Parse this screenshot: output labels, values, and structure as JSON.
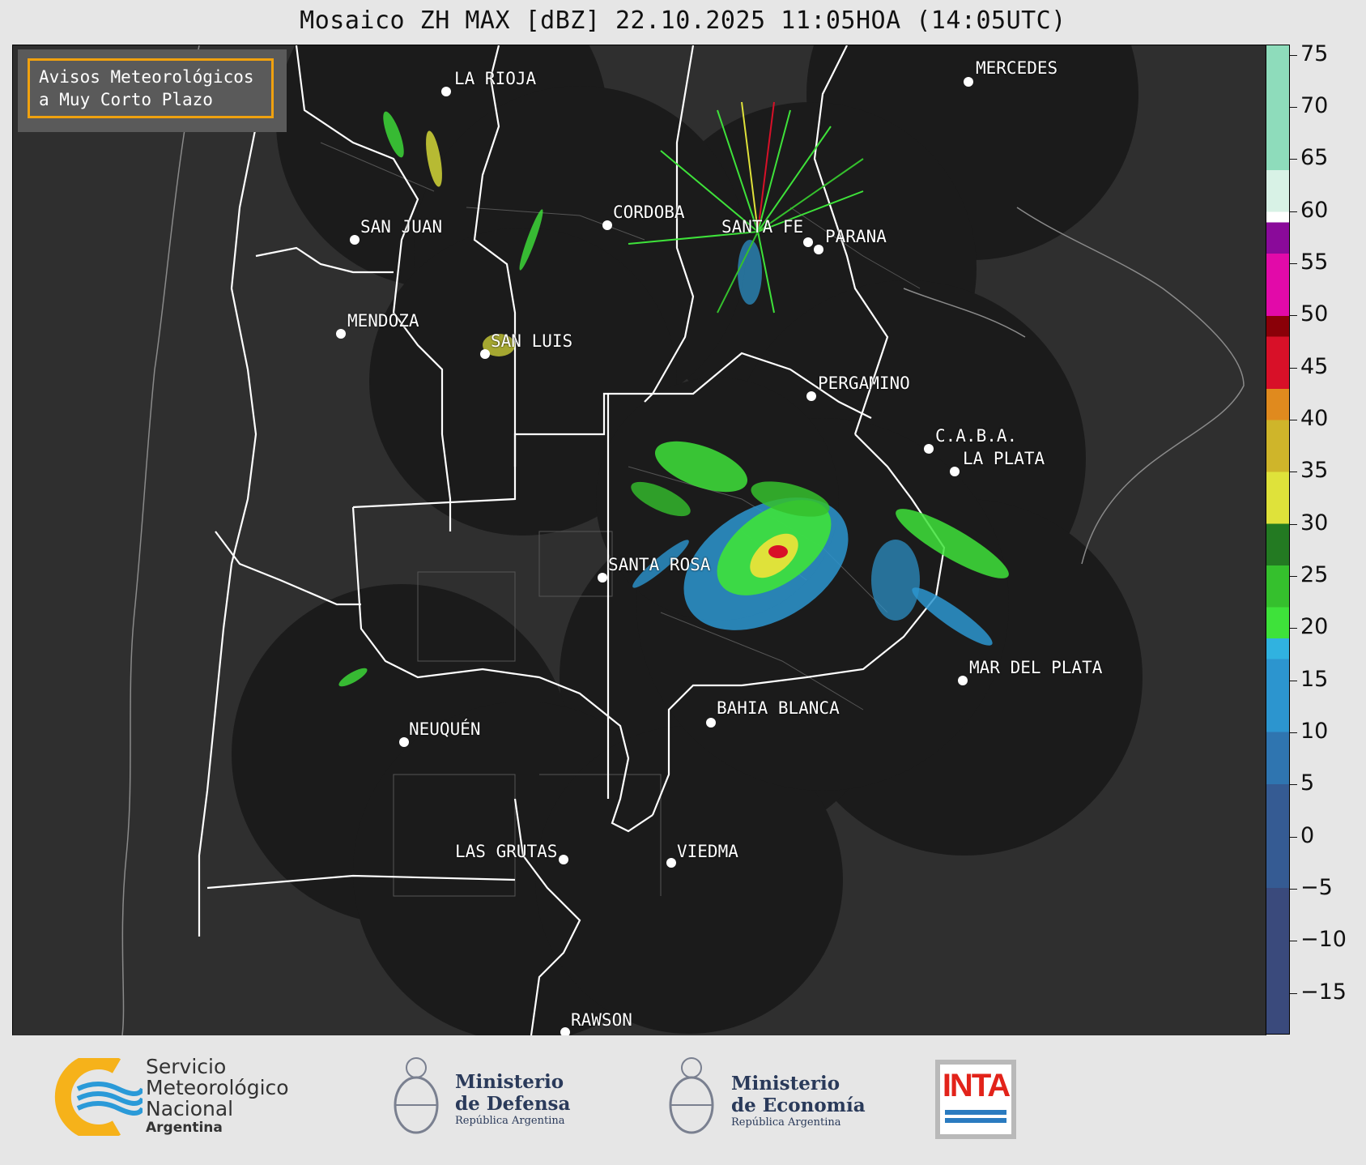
{
  "title": "Mosaico ZH MAX [dBZ] 22.10.2025 11:05HOA (14:05UTC)",
  "avisos": {
    "line1": "Avisos Meteorológicos",
    "line2": "a Muy Corto Plazo"
  },
  "cities": [
    {
      "id": "la-rioja",
      "label": "LA RIOJA"
    },
    {
      "id": "mercedes",
      "label": "MERCEDES"
    },
    {
      "id": "cordoba",
      "label": "CORDOBA"
    },
    {
      "id": "san-juan",
      "label": "SAN JUAN"
    },
    {
      "id": "santa-fe",
      "label": "SANTA FE"
    },
    {
      "id": "parana",
      "label": "PARANA"
    },
    {
      "id": "mendoza",
      "label": "MENDOZA"
    },
    {
      "id": "san-luis",
      "label": "SAN LUIS"
    },
    {
      "id": "pergamino",
      "label": "PERGAMINO"
    },
    {
      "id": "caba",
      "label": "C.A.B.A."
    },
    {
      "id": "la-plata",
      "label": "LA PLATA"
    },
    {
      "id": "santa-rosa",
      "label": "SANTA ROSA"
    },
    {
      "id": "mar-del-plata",
      "label": "MAR DEL PLATA"
    },
    {
      "id": "bahia-blanca",
      "label": "BAHIA BLANCA"
    },
    {
      "id": "neuquen",
      "label": "NEUQUÉN"
    },
    {
      "id": "las-grutas",
      "label": "LAS GRUTAS"
    },
    {
      "id": "viedma",
      "label": "VIEDMA"
    },
    {
      "id": "rawson",
      "label": "RAWSON"
    }
  ],
  "colorbar": {
    "unit": "dBZ",
    "ticks": [
      "75",
      "70",
      "65",
      "60",
      "55",
      "50",
      "45",
      "40",
      "35",
      "30",
      "25",
      "20",
      "15",
      "10",
      "5",
      "0",
      "−5",
      "−10",
      "−15"
    ],
    "min": -19,
    "max": 76,
    "bands": [
      {
        "from": -19,
        "to": -5,
        "color": "#3a4a7c"
      },
      {
        "from": -5,
        "to": 5,
        "color": "#355b93"
      },
      {
        "from": 5,
        "to": 10,
        "color": "#2f75b0"
      },
      {
        "from": 10,
        "to": 17,
        "color": "#2c95cf"
      },
      {
        "from": 17,
        "to": 19,
        "color": "#30b2e0"
      },
      {
        "from": 19,
        "to": 22,
        "color": "#3ee23a"
      },
      {
        "from": 22,
        "to": 26,
        "color": "#35c02d"
      },
      {
        "from": 26,
        "to": 30,
        "color": "#237a22"
      },
      {
        "from": 30,
        "to": 35,
        "color": "#dfe23a"
      },
      {
        "from": 35,
        "to": 40,
        "color": "#cfb52a"
      },
      {
        "from": 40,
        "to": 43,
        "color": "#e08a1e"
      },
      {
        "from": 43,
        "to": 48,
        "color": "#d81028"
      },
      {
        "from": 48,
        "to": 50,
        "color": "#8a0008"
      },
      {
        "from": 50,
        "to": 56,
        "color": "#e20aa9"
      },
      {
        "from": 56,
        "to": 59,
        "color": "#8a0a9a"
      },
      {
        "from": 59,
        "to": 60,
        "color": "#ffffff"
      },
      {
        "from": 60,
        "to": 64,
        "color": "#d8f2e6"
      },
      {
        "from": 64,
        "to": 76,
        "color": "#8edcbb"
      }
    ]
  },
  "footer": {
    "smn": {
      "line1": "Servicio",
      "line2": "Meteorológico",
      "line3": "Nacional",
      "line4": "Argentina"
    },
    "defensa": {
      "line1": "Ministerio",
      "line2": "de Defensa",
      "line3": "República Argentina"
    },
    "economia": {
      "line1": "Ministerio",
      "line2": "de Economía",
      "line3": "República Argentina"
    },
    "inta": "INTA"
  },
  "colors": {
    "map_bg": "#2f2f2f",
    "coverage": "#1b1b1b",
    "border": "#ffffff",
    "avisos_border": "#f0a10f"
  }
}
